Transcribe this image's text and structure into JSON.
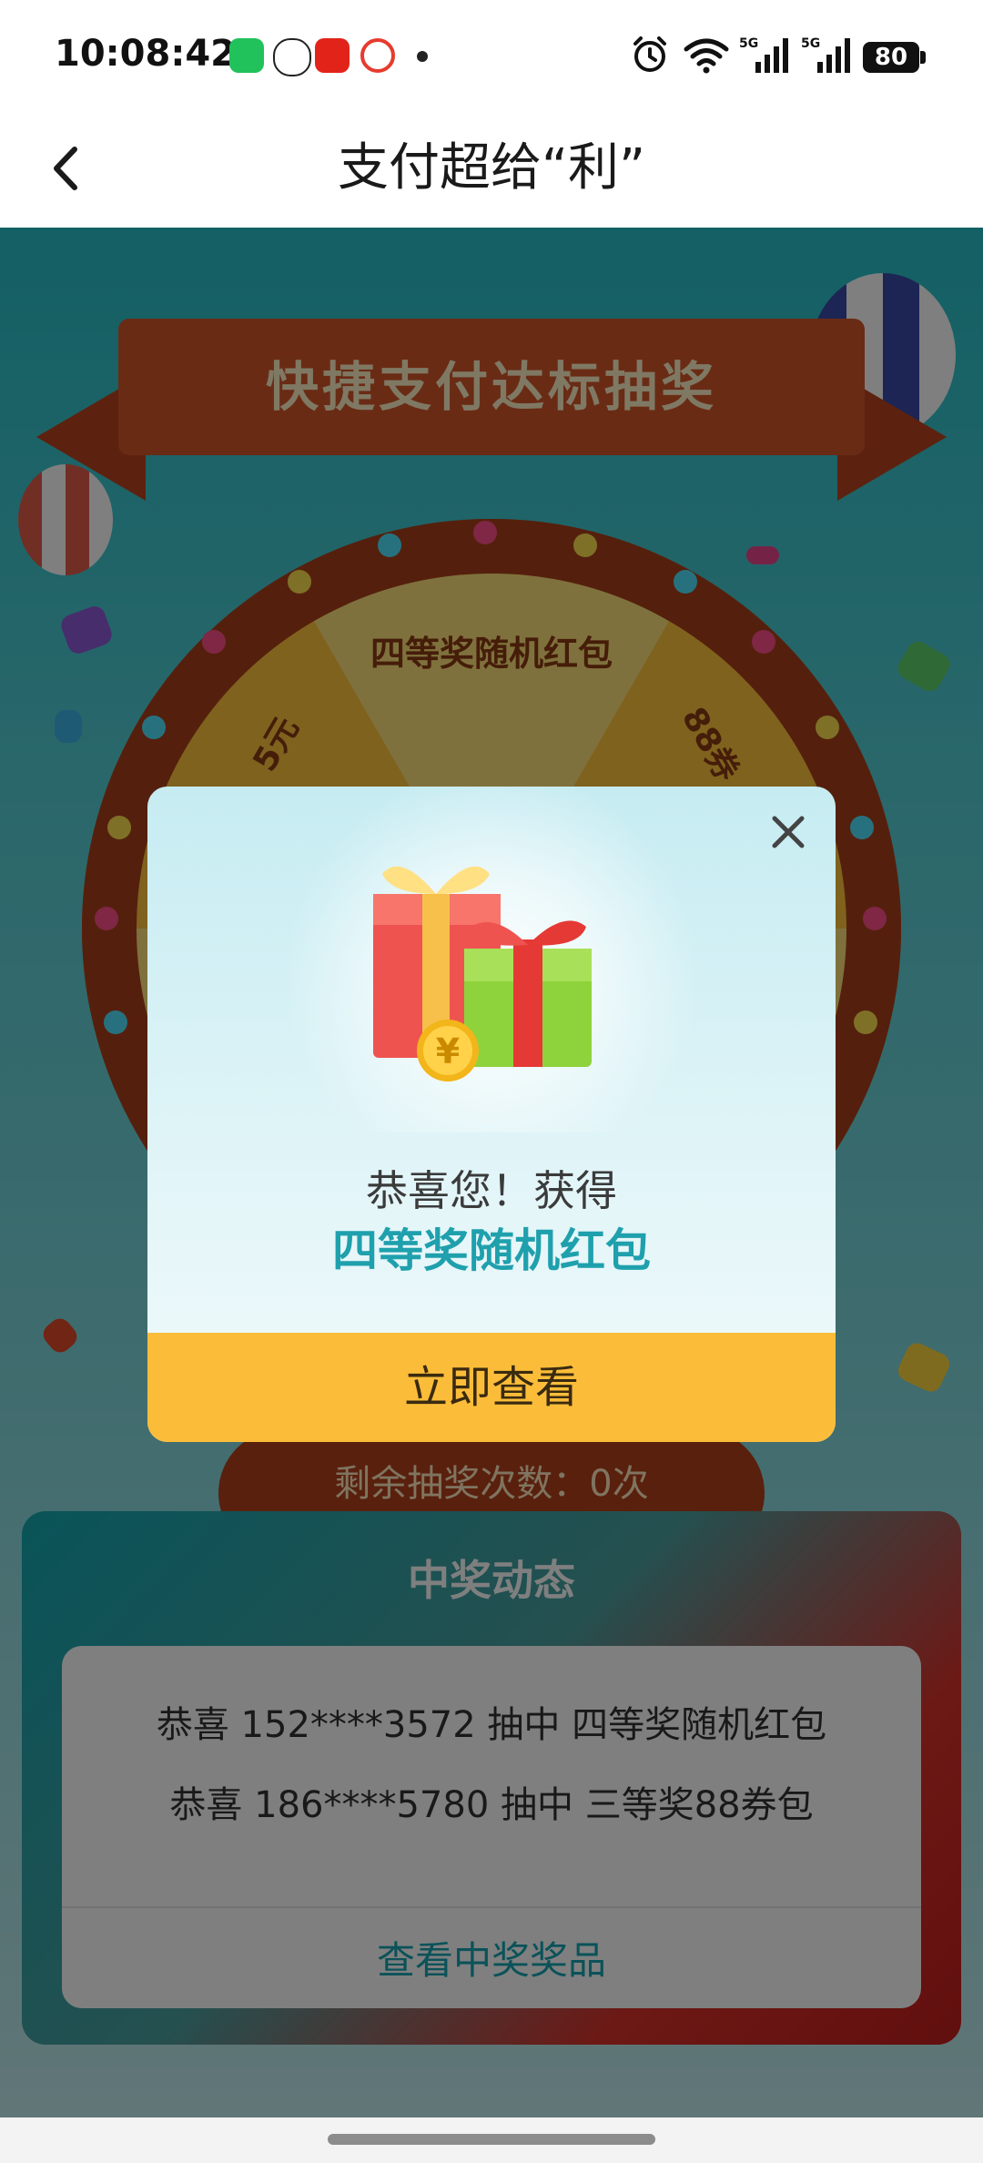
{
  "status_bar": {
    "time": "10:08:42",
    "battery": "80",
    "network_1": "5G",
    "network_2": "5G"
  },
  "nav": {
    "title": "支付超给“利”",
    "back_icon": "chevron-left-icon"
  },
  "activity": {
    "banner_title": "快捷支付达标抽奖",
    "wheel_prize_top": "四等奖随机红包",
    "wheel_prize_left": "5元",
    "wheel_prize_right": "88券",
    "chances_text": "剩余抽奖次数：0次"
  },
  "winners": {
    "title": "中奖动态",
    "rows": [
      "恭喜 152****3572 抽中 四等奖随机红包",
      "恭喜 186****5780 抽中 三等奖88券包"
    ],
    "view_link": "查看中奖奖品"
  },
  "modal": {
    "congrats": "恭喜您！获得",
    "prize": "四等奖随机红包",
    "action_label": "立即查看",
    "close_icon": "close-icon",
    "gift_icon": "gift-icon",
    "coin_symbol": "¥"
  },
  "colors": {
    "accent_teal": "#1fa0ad",
    "button_yellow": "#fbbd39",
    "ribbon_orange": "#d5562a"
  }
}
